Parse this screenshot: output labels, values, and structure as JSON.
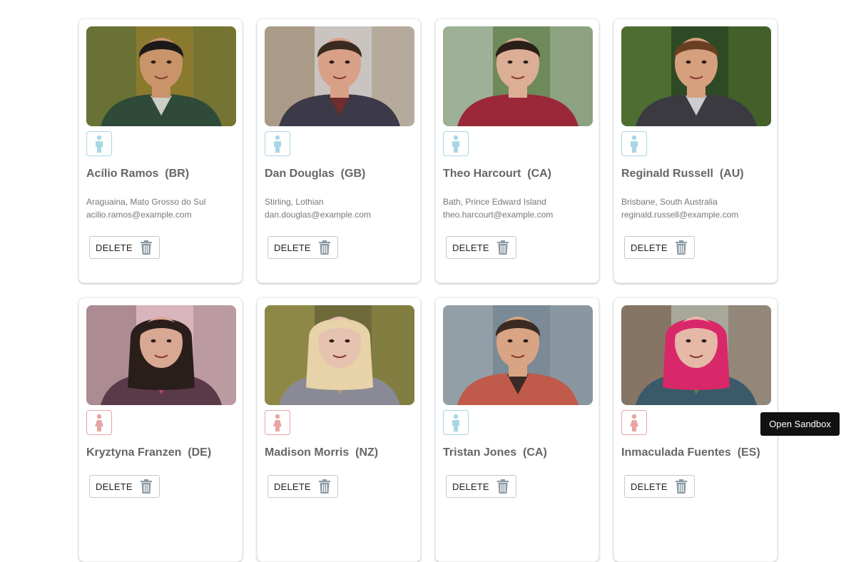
{
  "cards": [
    {
      "name": "Acílio Ramos  (BR)",
      "location": "Araguaina, Mato Grosso do Sul",
      "email": "acilio.ramos@example.com",
      "gender": "male",
      "delete_label": "DELETE",
      "photo": {
        "bg": "#8a7a2e",
        "bg2": "#4e6b3a",
        "skin": "#c9946a",
        "hair": "#1c1a18",
        "shirt": "#2f4a38",
        "accent": "#e8e6e0"
      }
    },
    {
      "name": "Dan Douglas  (GB)",
      "location": "Stirling, Lothian",
      "email": "dan.douglas@example.com",
      "gender": "male",
      "delete_label": "DELETE",
      "photo": {
        "bg": "#c9c4c0",
        "bg2": "#8f7a5a",
        "skin": "#d9a088",
        "hair": "#3a2a20",
        "shirt": "#3c3a48",
        "accent": "#7a2a2a"
      }
    },
    {
      "name": "Theo Harcourt  (CA)",
      "location": "Bath, Prince Edward Island",
      "email": "theo.harcourt@example.com",
      "gender": "male",
      "delete_label": "DELETE",
      "photo": {
        "bg": "#6e8a5a",
        "bg2": "#c7cfc8",
        "skin": "#dcae95",
        "hair": "#2a1e18",
        "shirt": "#9a2838",
        "accent": "#9a2838"
      }
    },
    {
      "name": "Reginald Russell  (AU)",
      "location": "Brisbane, South Australia",
      "email": "reginald.russell@example.com",
      "gender": "male",
      "delete_label": "DELETE",
      "photo": {
        "bg": "#2e4a24",
        "bg2": "#6a8a3a",
        "skin": "#d6a07e",
        "hair": "#6a3e22",
        "shirt": "#3a3a40",
        "accent": "#e6e8ea"
      }
    },
    {
      "name": "Kryztyna Franzen  (DE)",
      "location": "",
      "email": "",
      "gender": "female",
      "delete_label": "DELETE",
      "photo": {
        "bg": "#d8b4bc",
        "bg2": "#8a6a70",
        "skin": "#d8a892",
        "hair": "#2a1e1a",
        "shirt": "#5a3a48",
        "accent": "#c24a6a"
      }
    },
    {
      "name": "Madison Morris  (NZ)",
      "location": "",
      "email": "",
      "gender": "female",
      "delete_label": "DELETE",
      "photo": {
        "bg": "#6e6a3a",
        "bg2": "#a8a050",
        "skin": "#e6c2b0",
        "hair": "#e8d2a8",
        "shirt": "#8a8a96",
        "accent": "#c49a6a"
      }
    },
    {
      "name": "Tristan Jones  (CA)",
      "location": "",
      "email": "",
      "gender": "male",
      "delete_label": "DELETE",
      "photo": {
        "bg": "#7a8a96",
        "bg2": "#a8b0b4",
        "skin": "#d8a484",
        "hair": "#3a2a22",
        "shirt": "#c05a4a",
        "accent": "#222222"
      }
    },
    {
      "name": "Inmaculada Fuentes  (ES)",
      "location": "",
      "email": "",
      "gender": "female",
      "delete_label": "DELETE",
      "photo": {
        "bg": "#a8a89a",
        "bg2": "#6a4a3a",
        "skin": "#e6b8a8",
        "hair": "#d8286a",
        "shirt": "#3a5a6a",
        "accent": "#6a8a4a"
      }
    }
  ],
  "colors": {
    "male_icon": "#a9d6e5",
    "female_icon": "#e8a4a4",
    "trash_icon": "#8a9aa4"
  },
  "sandbox_button": "Open Sandbox"
}
